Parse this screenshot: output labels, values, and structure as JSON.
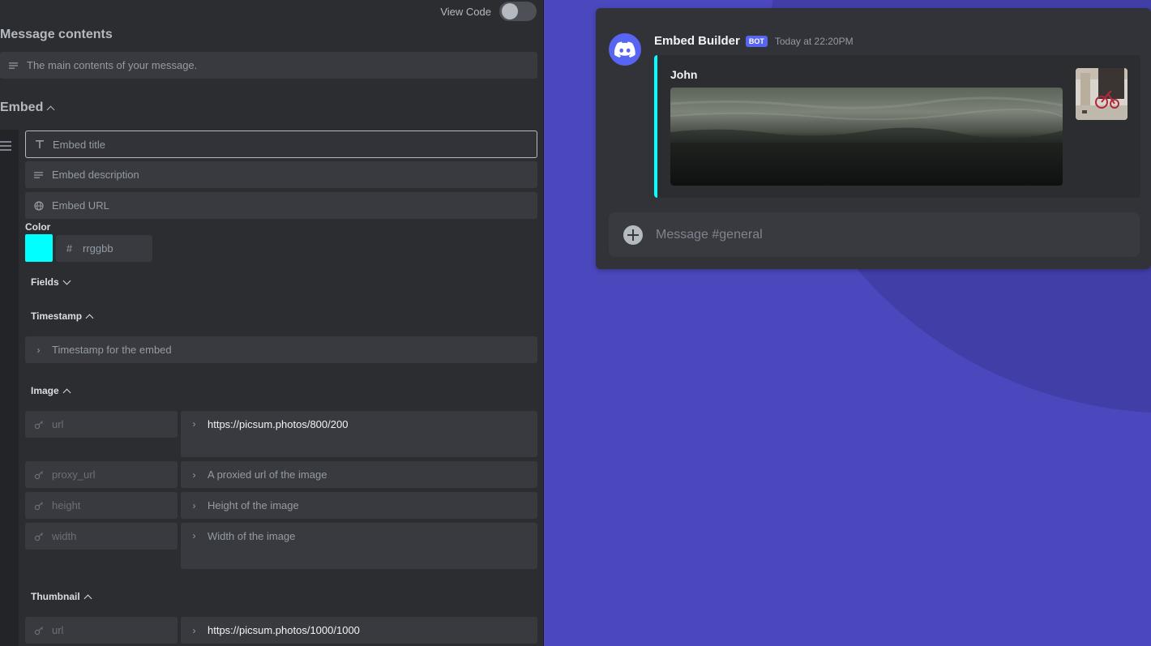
{
  "header": {
    "view_code_label": "View Code",
    "view_code_on": false
  },
  "message": {
    "title": "Message contents",
    "content_placeholder": "The main contents of your message."
  },
  "embed": {
    "title": "Embed",
    "title_placeholder": "Embed title",
    "description_placeholder": "Embed description",
    "url_placeholder": "Embed URL",
    "color_label": "Color",
    "color_value": "#00ffff",
    "color_placeholder": "rrggbb",
    "fields_label": "Fields",
    "timestamp": {
      "label": "Timestamp",
      "placeholder": "Timestamp for the embed"
    },
    "image": {
      "label": "Image",
      "rows": [
        {
          "key": "url",
          "value": "https://picsum.photos/800/200",
          "placeholder": ""
        },
        {
          "key": "proxy_url",
          "value": "",
          "placeholder": "A proxied url of the image"
        },
        {
          "key": "height",
          "value": "",
          "placeholder": "Height of the image"
        },
        {
          "key": "width",
          "value": "",
          "placeholder": "Width of the image"
        }
      ]
    },
    "thumbnail": {
      "label": "Thumbnail",
      "rows": [
        {
          "key": "url",
          "value": "https://picsum.photos/1000/1000"
        }
      ]
    }
  },
  "preview": {
    "author": "Embed Builder",
    "badge": "BOT",
    "timestamp": "Today at 22:20PM",
    "embed_name": "John",
    "accent_color": "#00ffff",
    "message_placeholder": "Message #general"
  }
}
